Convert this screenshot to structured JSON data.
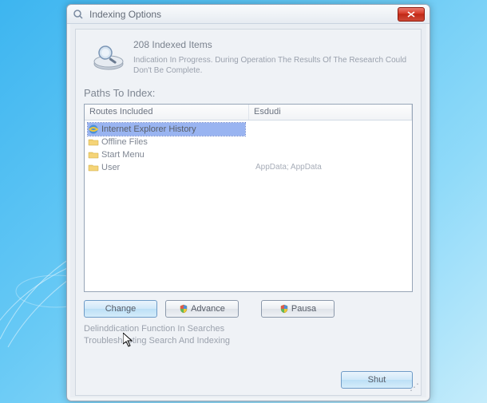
{
  "window": {
    "title": "Indexing Options"
  },
  "header": {
    "count_text": "208 Indexed Items",
    "progress_text": "Indication In Progress. During Operation The Results Of The Research Could Don't Be Complete."
  },
  "section": {
    "label": "Paths To Index:"
  },
  "list": {
    "col1": "Routes Included",
    "col2": "Esdudi",
    "rows": [
      {
        "icon": "ie",
        "label": "Internet Explorer History",
        "selected": true
      },
      {
        "icon": "folder",
        "label": "Offline Files",
        "selected": false
      },
      {
        "icon": "folder",
        "label": "Start Menu",
        "selected": false
      },
      {
        "icon": "folder",
        "label": "User",
        "selected": false
      }
    ],
    "exclude": "AppData; AppData"
  },
  "buttons": {
    "change": "Change",
    "advanced": "Advance",
    "pause": "Pausa",
    "close": "Shut"
  },
  "links": {
    "how": "Delinddication Function In Searches",
    "troubleshoot": "Troubleshooting Search And Indexing"
  }
}
